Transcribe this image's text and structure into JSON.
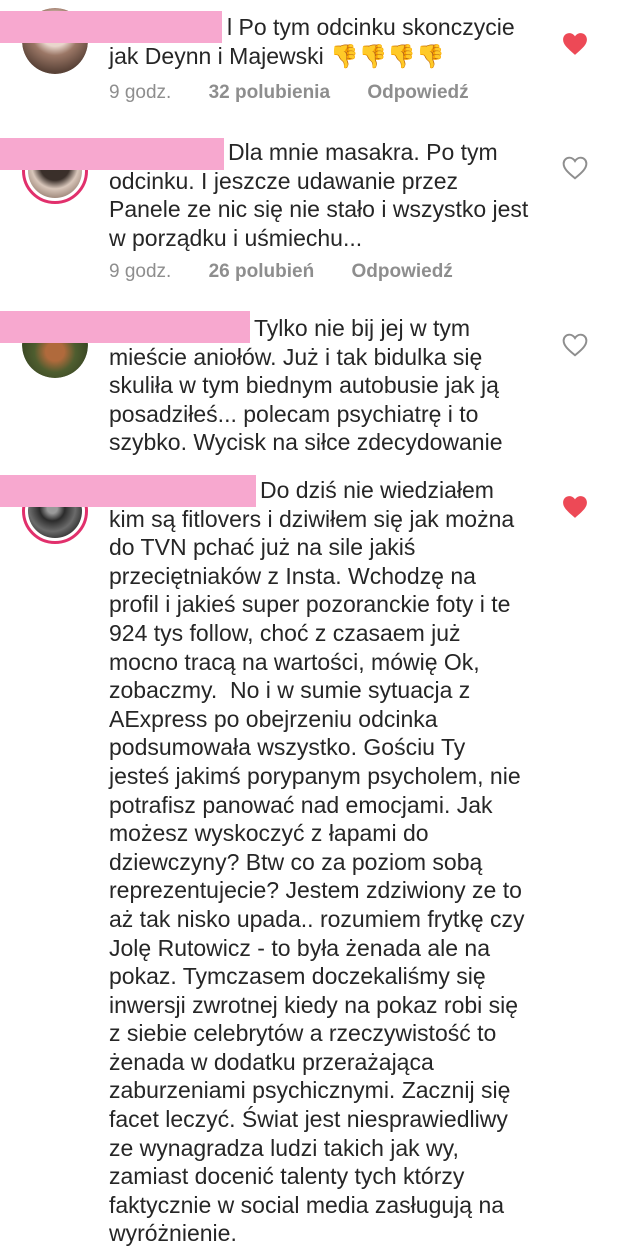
{
  "comments": [
    {
      "text": "l Po tym odcinku skonczycie jak Deynn i Majewski 👎👎👎👎",
      "time": "9 godz.",
      "likes": "32 polubienia",
      "reply": "Odpowiedź",
      "liked": true
    },
    {
      "text": "Dla mnie masakra. Po tym odcinku. I jeszcze udawanie przez Panele ze nic się nie stało i wszystko jest w porządku i uśmiechu...",
      "time": "9 godz.",
      "likes": "26 polubień",
      "reply": "Odpowiedź",
      "liked": false
    },
    {
      "text": "Tylko nie bij jej w tym mieście aniołów. Już i tak bidulka się skuliła w tym biednym autobusie jak ją posadziłeś... polecam psychiatrę i to szybko. Wycisk na siłce zdecydowanie",
      "liked": false
    },
    {
      "text": "Do dziś nie wiedziałem kim są fitlovers i dziwiłem się jak można do TVN pchać już na sile jakiś przeciętniaków z Insta. Wchodzę na profil i jakieś super pozoranckie foty i te 924 tys follow, choć z czasaem już mocno tracą na wartości, mówię Ok, zobaczmy.  No i w sumie sytuacja z AExpress po obejrzeniu odcinka podsumowała wszystko. Gościu Ty jesteś jakimś porypanym psycholem, nie potrafisz panować nad emocjami. Jak możesz wyskoczyć z łapami do dziewczyny? Btw co za poziom sobą reprezentujecie? Jestem zdziwiony ze to aż tak nisko upada.. rozumiem frytkę czy Jolę Rutowicz - to była żenada ale na pokaz. Tymczasem doczekaliśmy się inwersji zwrotnej kiedy na pokaz robi się z siebie celebrytów a rzeczywistość to żenada w dodatku przerażająca zaburzeniami psychicznymi. Zacznij się facet leczyć. Świat jest niesprawiedliwy ze wynagradza ludzi takich jak wy, zamiast docenić talenty tych którzy faktycznie w social media zasługują na wyróżnienie.",
      "liked": true
    }
  ],
  "colors": {
    "heart_liked": "#ed4956",
    "heart_outline": "#8e8e8e",
    "redaction": "#f7a8cf",
    "story_ring": "#e1306c"
  },
  "icons": {
    "liked": "heart-filled-icon",
    "unliked": "heart-outline-icon"
  }
}
